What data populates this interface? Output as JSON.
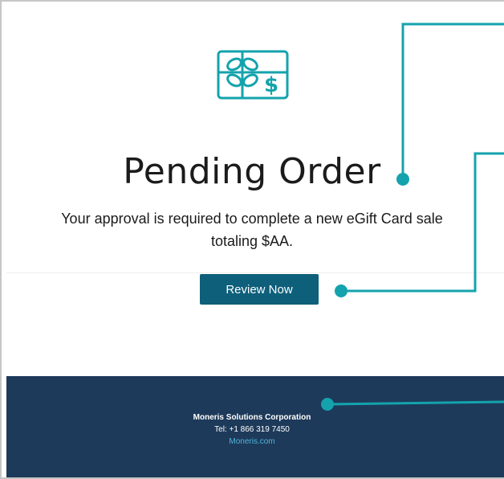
{
  "email": {
    "title": "Pending Order",
    "message": "Your approval is required to complete a new eGift Card sale totaling $AA.",
    "cta_label": "Review Now"
  },
  "footer": {
    "company": "Moneris Solutions Corporation",
    "tel": "Tel: +1 866 319 7450",
    "link": "Moneris.com"
  },
  "icons": {
    "gift_card": "gift-card-icon"
  },
  "colors": {
    "accent_teal": "#14a3ad",
    "button": "#0d5f7a",
    "footer_bg": "#1e3a5a",
    "link": "#4fb3d9",
    "callout_line": "#14a3ad"
  }
}
